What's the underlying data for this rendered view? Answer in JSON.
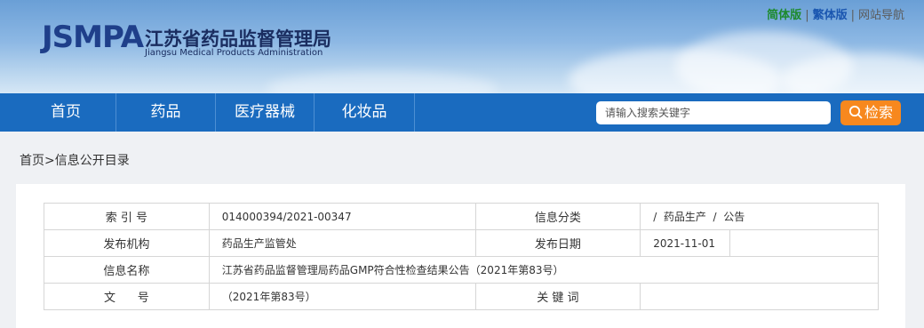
{
  "header": {
    "logo_en": "JSMPA",
    "logo_cn": "江苏省药品监督管理局",
    "logo_sub": "Jiangsu Medical Products Administration",
    "top_links": {
      "simplified": "简体版",
      "traditional": "繁体版",
      "site_nav": "网站导航",
      "separator": "|"
    }
  },
  "nav": {
    "items": [
      "首页",
      "药品",
      "医疗器械",
      "化妆品"
    ]
  },
  "search": {
    "placeholder": "请输入搜索关键字",
    "button_label": "检索"
  },
  "breadcrumb": "首页>信息公开目录",
  "info": {
    "index_label": "索 引 号",
    "index_value": "014000394/2021-00347",
    "category_label": "信息分类",
    "category_value": "/  药品生产  /  公告",
    "org_label": "发布机构",
    "org_value": "药品生产监管处",
    "date_label": "发布日期",
    "date_value": "2021-11-01",
    "name_label": "信息名称",
    "name_value": "江苏省药品监督管理局药品GMP符合性检查结果公告（2021年第83号）",
    "doc_label": "文      号",
    "doc_value": "（2021年第83号）",
    "keyword_label": "关 键 词",
    "keyword_value": ""
  },
  "colors": {
    "nav_bg": "#1a6bbf",
    "search_button": "#f7881e",
    "simplified_link": "#1d8a2d",
    "traditional_link": "#1a56b0"
  }
}
